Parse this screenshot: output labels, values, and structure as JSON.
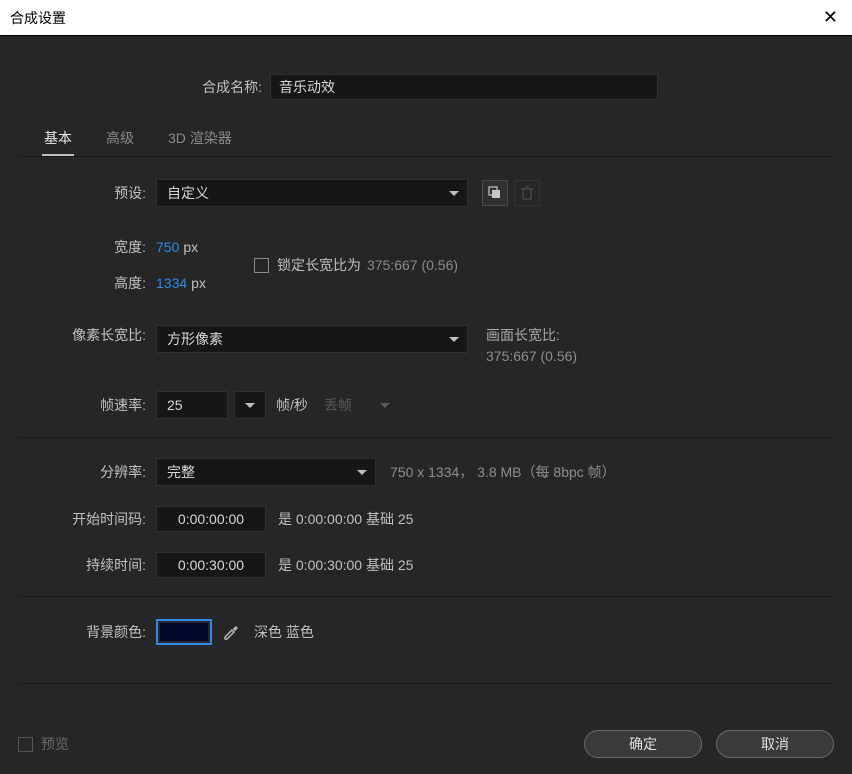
{
  "window": {
    "title": "合成设置"
  },
  "comp": {
    "name_label": "合成名称:",
    "name_value": "音乐动效"
  },
  "tabs": {
    "basic": "基本",
    "advanced": "高级",
    "renderer": "3D 渲染器"
  },
  "preset": {
    "label": "预设:",
    "value": "自定义"
  },
  "width": {
    "label": "宽度:",
    "value": "750",
    "unit": "px"
  },
  "height": {
    "label": "高度:",
    "value": "1334",
    "unit": "px"
  },
  "lock": {
    "label": "锁定长宽比为",
    "ratio": "375:667 (0.56)"
  },
  "par": {
    "label": "像素长宽比:",
    "value": "方形像素",
    "side_label": "画面长宽比:",
    "side_value": "375:667 (0.56)"
  },
  "fr": {
    "label": "帧速率:",
    "value": "25",
    "unit": "帧/秒",
    "dropframe": "丢帧"
  },
  "res": {
    "label": "分辨率:",
    "value": "完整",
    "info": "750 x 1334， 3.8 MB（每 8bpc 帧）"
  },
  "start": {
    "label": "开始时间码:",
    "value": "0:00:00:00",
    "info_prefix": "是",
    "info_tc": "0:00:00:00",
    "info_base": "基础",
    "info_rate": "25"
  },
  "dur": {
    "label": "持续时间:",
    "value": "0:00:30:00",
    "info_prefix": "是",
    "info_tc": "0:00:30:00",
    "info_base": "基础",
    "info_rate": "25"
  },
  "bg": {
    "label": "背景颜色:",
    "hex": "#04062b",
    "name": "深色 蓝色"
  },
  "footer": {
    "preview": "预览",
    "ok": "确定",
    "cancel": "取消"
  }
}
